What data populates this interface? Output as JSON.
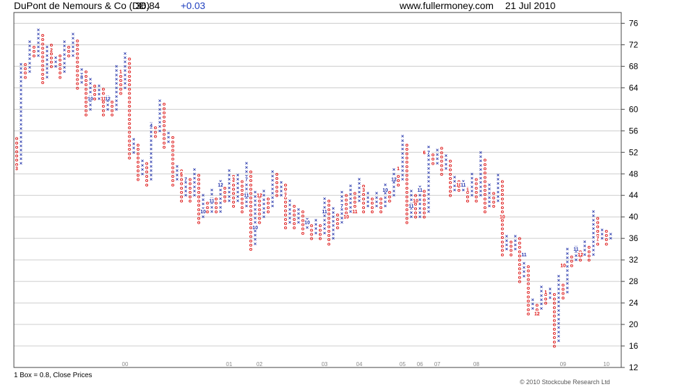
{
  "header": {
    "symbol": "DuPont de Nemours & Co (DD)",
    "price": "36.84",
    "change": "+0.03",
    "site": "www.fullermoney.com",
    "date": "21 Jul 2010"
  },
  "footer": {
    "box_info": "1 Box = 0.8, Close Prices",
    "copyright": "© 2010 Stockcube Research Ltd"
  },
  "colors": {
    "x": "#2233aa",
    "o": "#dd1111",
    "grid": "#cccccc",
    "frame": "#444444"
  },
  "chart_data": {
    "type": "point_and_figure",
    "box_size": 0.8,
    "ylim": [
      12,
      78
    ],
    "y_ticks": [
      12,
      16,
      20,
      24,
      28,
      32,
      36,
      40,
      44,
      48,
      52,
      56,
      60,
      64,
      68,
      72,
      76
    ],
    "x_labels": [
      "00",
      "01",
      "02",
      "03",
      "04",
      "05",
      "06",
      "07",
      "08",
      "09",
      "10"
    ],
    "columns": [
      {
        "t": "O",
        "lo": 49,
        "hi": 55
      },
      {
        "t": "X",
        "lo": 50,
        "hi": 69
      },
      {
        "t": "O",
        "lo": 66,
        "hi": 69
      },
      {
        "t": "X",
        "lo": 67,
        "hi": 73
      },
      {
        "t": "O",
        "lo": 70,
        "hi": 72
      },
      {
        "t": "X",
        "lo": 70,
        "hi": 75
      },
      {
        "t": "O",
        "lo": 65,
        "hi": 74
      },
      {
        "t": "X",
        "lo": 66,
        "hi": 72
      },
      {
        "t": "O",
        "lo": 68,
        "hi": 72
      },
      {
        "t": "X",
        "lo": 68,
        "hi": 70
      },
      {
        "t": "O",
        "lo": 66,
        "hi": 70
      },
      {
        "t": "X",
        "lo": 67,
        "hi": 73
      },
      {
        "t": "O",
        "lo": 70,
        "hi": 72
      },
      {
        "t": "X",
        "lo": 70,
        "hi": 74
      },
      {
        "t": "O",
        "lo": 64,
        "hi": 73
      },
      {
        "t": "X",
        "lo": 65,
        "hi": 68
      },
      {
        "t": "O",
        "lo": 59,
        "hi": 67
      },
      {
        "t": "X",
        "lo": 60,
        "hi": 66
      },
      {
        "t": "O",
        "lo": 62,
        "hi": 65
      },
      {
        "t": "X",
        "lo": 62,
        "hi": 65
      },
      {
        "t": "O",
        "lo": 59,
        "hi": 64
      },
      {
        "t": "X",
        "lo": 60,
        "hi": 63
      },
      {
        "t": "O",
        "lo": 59,
        "hi": 62
      },
      {
        "t": "X",
        "lo": 60,
        "hi": 68
      },
      {
        "t": "O",
        "lo": 63,
        "hi": 67
      },
      {
        "t": "X",
        "lo": 64,
        "hi": 71
      },
      {
        "t": "O",
        "lo": 51,
        "hi": 70
      },
      {
        "t": "X",
        "lo": 52,
        "hi": 55
      },
      {
        "t": "O",
        "lo": 47,
        "hi": 54
      },
      {
        "t": "X",
        "lo": 48,
        "hi": 51
      },
      {
        "t": "O",
        "lo": 46,
        "hi": 50
      },
      {
        "t": "X",
        "lo": 47,
        "hi": 58
      },
      {
        "t": "O",
        "lo": 55,
        "hi": 57
      },
      {
        "t": "X",
        "lo": 56,
        "hi": 62
      },
      {
        "t": "O",
        "lo": 53,
        "hi": 61
      },
      {
        "t": "X",
        "lo": 54,
        "hi": 56
      },
      {
        "t": "O",
        "lo": 46,
        "hi": 55
      },
      {
        "t": "X",
        "lo": 47,
        "hi": 50
      },
      {
        "t": "O",
        "lo": 43,
        "hi": 49
      },
      {
        "t": "X",
        "lo": 44,
        "hi": 47
      },
      {
        "t": "O",
        "lo": 43,
        "hi": 47
      },
      {
        "t": "X",
        "lo": 44,
        "hi": 49
      },
      {
        "t": "O",
        "lo": 39,
        "hi": 48
      },
      {
        "t": "X",
        "lo": 40,
        "hi": 44
      },
      {
        "t": "O",
        "lo": 41,
        "hi": 43
      },
      {
        "t": "X",
        "lo": 41,
        "hi": 45
      },
      {
        "t": "O",
        "lo": 41,
        "hi": 44
      },
      {
        "t": "X",
        "lo": 41,
        "hi": 47
      },
      {
        "t": "O",
        "lo": 43,
        "hi": 46
      },
      {
        "t": "X",
        "lo": 43,
        "hi": 49
      },
      {
        "t": "O",
        "lo": 42,
        "hi": 48
      },
      {
        "t": "X",
        "lo": 43,
        "hi": 48
      },
      {
        "t": "O",
        "lo": 41,
        "hi": 47
      },
      {
        "t": "X",
        "lo": 42,
        "hi": 50
      },
      {
        "t": "O",
        "lo": 34,
        "hi": 49
      },
      {
        "t": "X",
        "lo": 35,
        "hi": 45
      },
      {
        "t": "O",
        "lo": 39,
        "hi": 44
      },
      {
        "t": "X",
        "lo": 40,
        "hi": 45
      },
      {
        "t": "O",
        "lo": 41,
        "hi": 44
      },
      {
        "t": "X",
        "lo": 42,
        "hi": 49
      },
      {
        "t": "O",
        "lo": 44,
        "hi": 48
      },
      {
        "t": "X",
        "lo": 44,
        "hi": 47
      },
      {
        "t": "O",
        "lo": 38,
        "hi": 46
      },
      {
        "t": "X",
        "lo": 39,
        "hi": 43
      },
      {
        "t": "O",
        "lo": 38,
        "hi": 42
      },
      {
        "t": "X",
        "lo": 39,
        "hi": 42
      },
      {
        "t": "O",
        "lo": 37,
        "hi": 41
      },
      {
        "t": "X",
        "lo": 38,
        "hi": 40
      },
      {
        "t": "O",
        "lo": 36,
        "hi": 39
      },
      {
        "t": "X",
        "lo": 37,
        "hi": 40
      },
      {
        "t": "O",
        "lo": 36,
        "hi": 39
      },
      {
        "t": "X",
        "lo": 37,
        "hi": 44
      },
      {
        "t": "O",
        "lo": 35,
        "hi": 43
      },
      {
        "t": "X",
        "lo": 36,
        "hi": 42
      },
      {
        "t": "O",
        "lo": 38,
        "hi": 41
      },
      {
        "t": "X",
        "lo": 39,
        "hi": 45
      },
      {
        "t": "O",
        "lo": 40,
        "hi": 44
      },
      {
        "t": "X",
        "lo": 41,
        "hi": 46
      },
      {
        "t": "O",
        "lo": 42,
        "hi": 45
      },
      {
        "t": "X",
        "lo": 43,
        "hi": 47
      },
      {
        "t": "O",
        "lo": 41,
        "hi": 46
      },
      {
        "t": "X",
        "lo": 42,
        "hi": 45
      },
      {
        "t": "O",
        "lo": 41,
        "hi": 44
      },
      {
        "t": "X",
        "lo": 42,
        "hi": 45
      },
      {
        "t": "O",
        "lo": 41,
        "hi": 44
      },
      {
        "t": "X",
        "lo": 42,
        "hi": 46
      },
      {
        "t": "O",
        "lo": 43,
        "hi": 45
      },
      {
        "t": "X",
        "lo": 44,
        "hi": 49
      },
      {
        "t": "O",
        "lo": 46,
        "hi": 48
      },
      {
        "t": "X",
        "lo": 47,
        "hi": 55
      },
      {
        "t": "O",
        "lo": 39,
        "hi": 54
      },
      {
        "t": "X",
        "lo": 40,
        "hi": 45
      },
      {
        "t": "O",
        "lo": 40,
        "hi": 44
      },
      {
        "t": "X",
        "lo": 40,
        "hi": 46
      },
      {
        "t": "O",
        "lo": 40,
        "hi": 45
      },
      {
        "t": "X",
        "lo": 41,
        "hi": 53
      },
      {
        "t": "O",
        "lo": 50,
        "hi": 52
      },
      {
        "t": "X",
        "lo": 50,
        "hi": 53
      },
      {
        "t": "O",
        "lo": 48,
        "hi": 53
      },
      {
        "t": "X",
        "lo": 49,
        "hi": 52
      },
      {
        "t": "O",
        "lo": 44,
        "hi": 51
      },
      {
        "t": "X",
        "lo": 45,
        "hi": 48
      },
      {
        "t": "O",
        "lo": 45,
        "hi": 47
      },
      {
        "t": "X",
        "lo": 45,
        "hi": 47
      },
      {
        "t": "O",
        "lo": 43,
        "hi": 46
      },
      {
        "t": "X",
        "lo": 44,
        "hi": 48
      },
      {
        "t": "O",
        "lo": 43,
        "hi": 47
      },
      {
        "t": "X",
        "lo": 44,
        "hi": 52
      },
      {
        "t": "O",
        "lo": 41,
        "hi": 51
      },
      {
        "t": "X",
        "lo": 42,
        "hi": 46
      },
      {
        "t": "O",
        "lo": 42,
        "hi": 45
      },
      {
        "t": "X",
        "lo": 43,
        "hi": 48
      },
      {
        "t": "O",
        "lo": 33,
        "hi": 47
      },
      {
        "t": "X",
        "lo": 34,
        "hi": 37
      },
      {
        "t": "O",
        "lo": 33,
        "hi": 36
      },
      {
        "t": "X",
        "lo": 34,
        "hi": 37
      },
      {
        "t": "O",
        "lo": 28,
        "hi": 36
      },
      {
        "t": "X",
        "lo": 29,
        "hi": 32
      },
      {
        "t": "O",
        "lo": 22,
        "hi": 31
      },
      {
        "t": "X",
        "lo": 23,
        "hi": 25
      },
      {
        "t": "O",
        "lo": 22,
        "hi": 24
      },
      {
        "t": "X",
        "lo": 23,
        "hi": 27
      },
      {
        "t": "O",
        "lo": 24,
        "hi": 26
      },
      {
        "t": "X",
        "lo": 25,
        "hi": 27
      },
      {
        "t": "O",
        "lo": 16,
        "hi": 26
      },
      {
        "t": "X",
        "lo": 17,
        "hi": 29
      },
      {
        "t": "O",
        "lo": 25,
        "hi": 28
      },
      {
        "t": "X",
        "lo": 26,
        "hi": 34
      },
      {
        "t": "O",
        "lo": 31,
        "hi": 33
      },
      {
        "t": "X",
        "lo": 32,
        "hi": 35
      },
      {
        "t": "O",
        "lo": 32,
        "hi": 34
      },
      {
        "t": "X",
        "lo": 33,
        "hi": 36
      },
      {
        "t": "O",
        "lo": 32,
        "hi": 35
      },
      {
        "t": "X",
        "lo": 33,
        "hi": 41
      },
      {
        "t": "O",
        "lo": 35,
        "hi": 40
      },
      {
        "t": "X",
        "lo": 36,
        "hi": 38
      },
      {
        "t": "O",
        "lo": 35,
        "hi": 38
      },
      {
        "t": "X",
        "lo": 36,
        "hi": 37
      }
    ],
    "month_marks": [
      {
        "c": 0,
        "v": 49,
        "m": "3"
      },
      {
        "c": 8,
        "v": 71,
        "m": "2"
      },
      {
        "c": 15,
        "v": 66,
        "m": "8"
      },
      {
        "c": 17,
        "v": 62,
        "m": "10"
      },
      {
        "c": 20,
        "v": 62,
        "m": "11"
      },
      {
        "c": 21,
        "v": 62,
        "m": "12"
      },
      {
        "c": 24,
        "v": 67,
        "m": "1"
      },
      {
        "c": 31,
        "v": 57,
        "m": "4"
      },
      {
        "c": 38,
        "v": 48,
        "m": "6"
      },
      {
        "c": 39,
        "v": 47,
        "m": "7"
      },
      {
        "c": 43,
        "v": 41,
        "m": "10"
      },
      {
        "c": 45,
        "v": 43,
        "m": "11"
      },
      {
        "c": 47,
        "v": 46,
        "m": "12"
      },
      {
        "c": 50,
        "v": 47,
        "m": "3"
      },
      {
        "c": 53,
        "v": 44,
        "m": "11"
      },
      {
        "c": 53,
        "v": 47,
        "m": "7"
      },
      {
        "c": 55,
        "v": 38,
        "m": "10"
      },
      {
        "c": 56,
        "v": 44,
        "m": "12"
      },
      {
        "c": 62,
        "v": 44,
        "m": "7"
      },
      {
        "c": 67,
        "v": 39,
        "m": "10"
      },
      {
        "c": 71,
        "v": 41,
        "m": "11"
      },
      {
        "c": 75,
        "v": 42,
        "m": "7"
      },
      {
        "c": 76,
        "v": 40,
        "m": "10"
      },
      {
        "c": 78,
        "v": 41,
        "m": "11"
      },
      {
        "c": 80,
        "v": 45,
        "m": "3"
      },
      {
        "c": 85,
        "v": 45,
        "m": "10"
      },
      {
        "c": 87,
        "v": 47,
        "m": "12"
      },
      {
        "c": 88,
        "v": 49,
        "m": "1"
      },
      {
        "c": 91,
        "v": 42,
        "m": "11"
      },
      {
        "c": 92,
        "v": 43,
        "m": "10"
      },
      {
        "c": 93,
        "v": 45,
        "m": "11"
      },
      {
        "c": 94,
        "v": 52,
        "m": "6"
      },
      {
        "c": 95,
        "v": 52,
        "m": "7"
      },
      {
        "c": 102,
        "v": 46,
        "m": "10"
      },
      {
        "c": 103,
        "v": 46,
        "m": "11"
      },
      {
        "c": 104,
        "v": 45,
        "m": "1"
      },
      {
        "c": 112,
        "v": 40,
        "m": "10"
      },
      {
        "c": 117,
        "v": 33,
        "m": "11"
      },
      {
        "c": 120,
        "v": 22,
        "m": "12"
      },
      {
        "c": 122,
        "v": 26,
        "m": "1"
      },
      {
        "c": 126,
        "v": 31,
        "m": "10"
      },
      {
        "c": 129,
        "v": 34,
        "m": "11"
      },
      {
        "c": 130,
        "v": 33,
        "m": "12"
      },
      {
        "c": 134,
        "v": 36,
        "m": "7"
      }
    ],
    "year_marks": [
      {
        "c": 25,
        "label": "00"
      },
      {
        "c": 49,
        "label": "01"
      },
      {
        "c": 56,
        "label": "02"
      },
      {
        "c": 71,
        "label": "03"
      },
      {
        "c": 79,
        "label": "04"
      },
      {
        "c": 89,
        "label": "05"
      },
      {
        "c": 93,
        "label": "06"
      },
      {
        "c": 97,
        "label": "07"
      },
      {
        "c": 106,
        "label": "08"
      },
      {
        "c": 126,
        "label": "09"
      },
      {
        "c": 136,
        "label": "10"
      }
    ]
  }
}
